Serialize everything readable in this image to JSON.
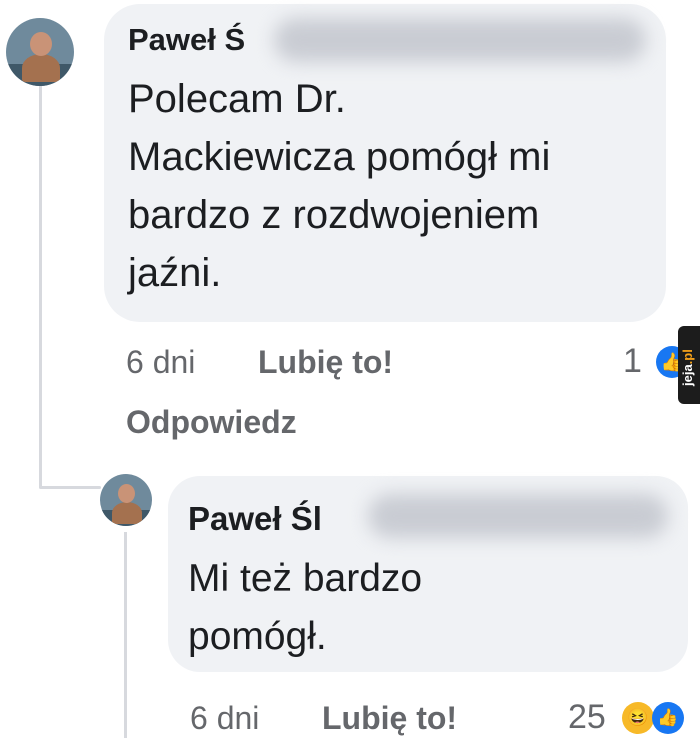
{
  "comment": {
    "author": "Paweł Ś",
    "lines": [
      "Polecam Dr.",
      "Mackiewicza pomógł mi",
      "bardzo z rozdwojeniem",
      "jaźni."
    ],
    "time": "6 dni",
    "like_label": "Lubię to!",
    "reply_label": "Odpowiedz",
    "reaction_count": "1",
    "reaction_icon": "like-icon"
  },
  "reply": {
    "author": "Paweł Śl",
    "lines": [
      "Mi też bardzo",
      "pomógł."
    ],
    "time": "6 dni",
    "like_label": "Lubię to!",
    "reaction_count": "25",
    "reaction_icons": [
      "haha-icon",
      "like-icon"
    ]
  },
  "watermark": {
    "prefix": "jeja",
    "suffix": ".pl"
  },
  "colors": {
    "bubble": "#f0f2f5",
    "meta": "#65676b",
    "like_blue": "#1877f2",
    "haha_yellow": "#f7b928"
  }
}
